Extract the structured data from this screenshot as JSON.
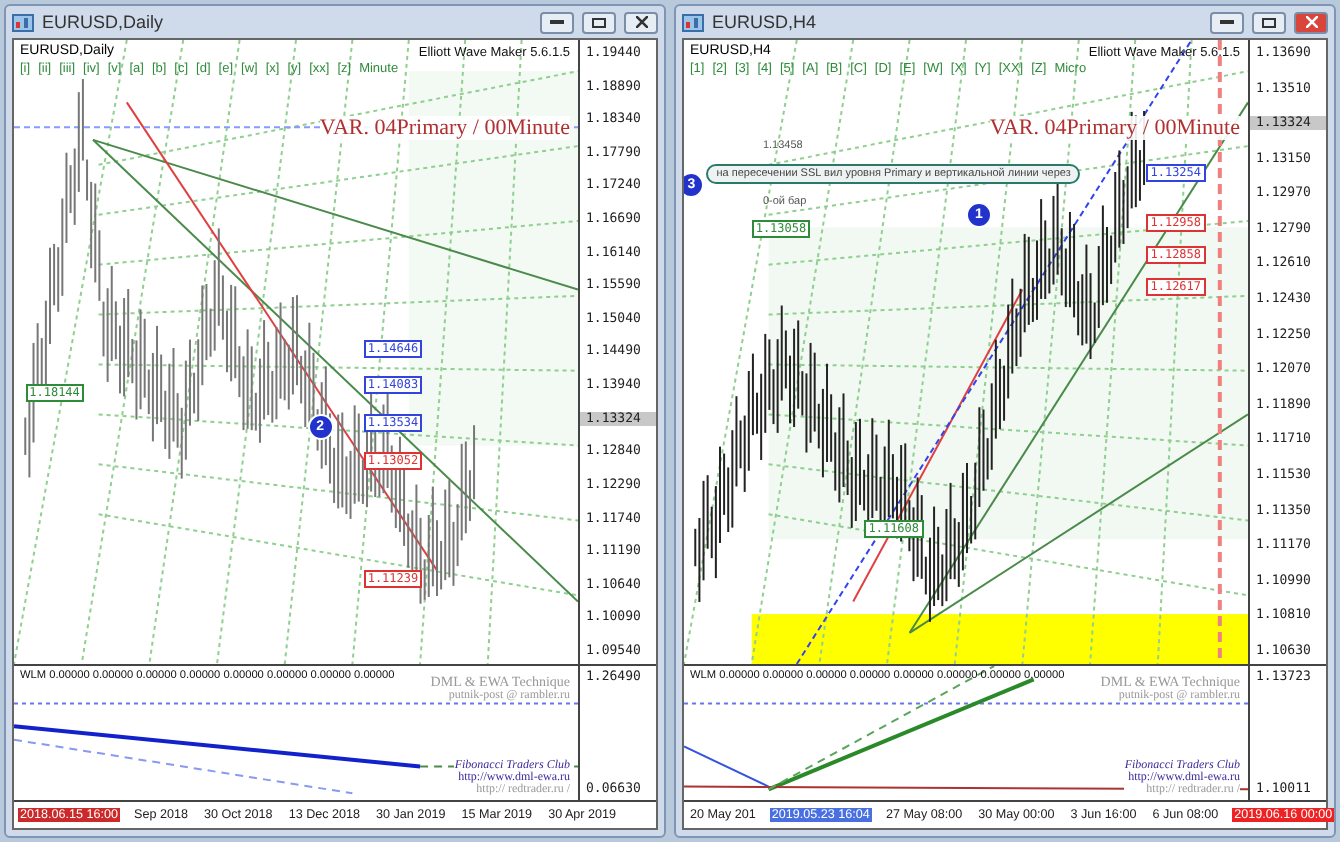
{
  "windows": [
    {
      "title": "EURUSD,Daily",
      "active": false,
      "chart_label": "EURUSD,Daily",
      "wave_labels": [
        "[i]",
        "[ii]",
        "[iii]",
        "[iv]",
        "[v]",
        "[a]",
        "[b]",
        "[c]",
        "[d]",
        "[e]",
        "[w]",
        "[x]",
        "[y]",
        "[xx]",
        "[z]",
        "Minute"
      ],
      "indicator_name": "Elliott Wave Maker 5.6.1.5",
      "variant": "VAR. 04Primary / 00Minute",
      "price_axis": [
        {
          "text": "1.19440",
          "kind": "tick"
        },
        {
          "text": "1.18890",
          "kind": "tick"
        },
        {
          "text": "1.18340",
          "kind": "tick"
        },
        {
          "text": "1.17790",
          "kind": "tick"
        },
        {
          "text": "1.17240",
          "kind": "tick"
        },
        {
          "text": "1.16690",
          "kind": "tick"
        },
        {
          "text": "1.16140",
          "kind": "tick"
        },
        {
          "text": "1.15590",
          "kind": "tick"
        },
        {
          "text": "1.15040",
          "kind": "tick"
        },
        {
          "text": "1.14490",
          "kind": "tick"
        },
        {
          "text": "1.13940",
          "kind": "tick"
        },
        {
          "text": "1.13324",
          "kind": "current"
        },
        {
          "text": "1.12840",
          "kind": "tick"
        },
        {
          "text": "1.12290",
          "kind": "tick"
        },
        {
          "text": "1.11740",
          "kind": "tick"
        },
        {
          "text": "1.11190",
          "kind": "tick"
        },
        {
          "text": "1.10640",
          "kind": "tick"
        },
        {
          "text": "1.10090",
          "kind": "tick"
        },
        {
          "text": "1.09540",
          "kind": "tick"
        }
      ],
      "price_tags": [
        {
          "text": "1.18144",
          "color": "#2e8b3a"
        },
        {
          "text": "1.14646",
          "color": "#3344dd"
        },
        {
          "text": "1.14083",
          "color": "#3344dd"
        },
        {
          "text": "1.13534",
          "color": "#3344dd"
        },
        {
          "text": "1.13052",
          "color": "#dd3333"
        },
        {
          "text": "1.11239",
          "color": "#dd3333"
        }
      ],
      "markers": [
        "2"
      ],
      "sub_legend": "WLM 0.00000 0.00000 0.00000 0.00000 0.00000 0.00000 0.00000 0.00000",
      "sub_axis": [
        "1.26490",
        "0.06630"
      ],
      "credits": [
        "DML & EWA Technique",
        "putnik-post @ rambler.ru"
      ],
      "links": [
        "Fibonacci Traders Club",
        "http://www.dml-ewa.ru",
        "http:// redtrader.ru /"
      ],
      "date_axis": [
        {
          "text": "2018.06.15 16:00",
          "kind": "marker",
          "color": "#cc2a2a"
        },
        {
          "text": "Sep 2018",
          "kind": "tick"
        },
        {
          "text": "30 Oct 2018",
          "kind": "tick"
        },
        {
          "text": "13 Dec 2018",
          "kind": "tick"
        },
        {
          "text": "30 Jan 2019",
          "kind": "tick"
        },
        {
          "text": "15 Mar 2019",
          "kind": "tick"
        },
        {
          "text": "30 Apr 2019",
          "kind": "tick"
        }
      ]
    },
    {
      "title": "EURUSD,H4",
      "active": true,
      "chart_label": "EURUSD,H4",
      "wave_labels": [
        "[1]",
        "[2]",
        "[3]",
        "[4]",
        "[5]",
        "[A]",
        "[B]",
        "[C]",
        "[D]",
        "[E]",
        "[W]",
        "[X]",
        "[Y]",
        "[XX]",
        "[Z]",
        "Micro"
      ],
      "indicator_name": "Elliott Wave Maker 5.6.1.5",
      "variant": "VAR. 04Primary / 00Minute",
      "price_axis": [
        {
          "text": "1.13690",
          "kind": "tick"
        },
        {
          "text": "1.13510",
          "kind": "tick"
        },
        {
          "text": "1.13324",
          "kind": "current"
        },
        {
          "text": "1.13150",
          "kind": "tick"
        },
        {
          "text": "1.12970",
          "kind": "tick"
        },
        {
          "text": "1.12790",
          "kind": "tick"
        },
        {
          "text": "1.12610",
          "kind": "tick"
        },
        {
          "text": "1.12430",
          "kind": "tick"
        },
        {
          "text": "1.12250",
          "kind": "tick"
        },
        {
          "text": "1.12070",
          "kind": "tick"
        },
        {
          "text": "1.11890",
          "kind": "tick"
        },
        {
          "text": "1.11710",
          "kind": "tick"
        },
        {
          "text": "1.11530",
          "kind": "tick"
        },
        {
          "text": "1.11350",
          "kind": "tick"
        },
        {
          "text": "1.11170",
          "kind": "tick"
        },
        {
          "text": "1.10990",
          "kind": "tick"
        },
        {
          "text": "1.10810",
          "kind": "tick"
        },
        {
          "text": "1.10630",
          "kind": "tick"
        }
      ],
      "price_tags": [
        {
          "text": "1.13254",
          "color": "#3344dd"
        },
        {
          "text": "1.12958",
          "color": "#dd3333"
        },
        {
          "text": "1.12858",
          "color": "#dd3333"
        },
        {
          "text": "1.12617",
          "color": "#dd3333"
        },
        {
          "text": "1.13058",
          "color": "#2e8b3a"
        },
        {
          "text": "1.11608",
          "color": "#2e8b3a"
        }
      ],
      "markers": [
        "3",
        "1"
      ],
      "notes": [
        "1.13458",
        "на пересечении SSL вил уровня Primary и вертикальной линии через",
        "0-ой бар"
      ],
      "sub_legend": "WLM 0.00000 0.00000 0.00000 0.00000 0.00000 0.00000 0.00000 0.00000",
      "sub_axis": [
        "1.13723",
        "1.10011"
      ],
      "credits": [
        "DML & EWA Technique",
        "putnik-post @ rambler.ru"
      ],
      "links": [
        "Fibonacci Traders Club",
        "http://www.dml-ewa.ru",
        "http:// redtrader.ru /"
      ],
      "date_axis": [
        {
          "text": "20 May 201",
          "kind": "tick"
        },
        {
          "text": "2019.05.23 16:04",
          "kind": "marker",
          "color": "#4a6fe0"
        },
        {
          "text": "27 May 08:00",
          "kind": "tick"
        },
        {
          "text": "30 May 00:00",
          "kind": "tick"
        },
        {
          "text": "3 Jun 16:00",
          "kind": "tick"
        },
        {
          "text": "6 Jun 08:00",
          "kind": "tick"
        },
        {
          "text": "2019.06.16 00:00",
          "kind": "marker",
          "color": "#ee2222"
        }
      ]
    }
  ]
}
